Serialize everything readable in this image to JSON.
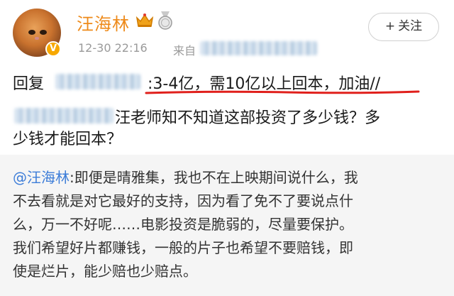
{
  "post": {
    "username": "汪海林",
    "time": "12-30 22:16",
    "from_label": "来自",
    "follow_plus": "+",
    "follow_label": "关注",
    "reply_prefix": "回复",
    "reply_text_line1": ":3-4亿，需10亿以上回本，加油//",
    "reply_text_line2": "汪老师知不知道这部投资了多少钱？多",
    "reply_text_line3": "少钱才能回本？"
  },
  "quote": {
    "mention": "@汪海林",
    "line1": ":即便是晴雅集，我也不在上映期间说什么，我",
    "line2": "不去看就是对它最好的支持，因为看了免不了要说点什",
    "line3": "么，万一不好呢……电影投资是脆弱的，尽量要保护。",
    "line4": "我们希望好片都赚钱，一般的片子也希望不要赔钱，即",
    "line5": "使是烂片，能少赔也少赔点。"
  },
  "colors": {
    "username": "#ee8a1a",
    "mention": "#3d7dd8",
    "underline": "#e0201c",
    "quote_bg": "#f5f5f5",
    "vip_badge": "#f7a800"
  },
  "icons": {
    "avatar": "cat-avatar",
    "verified": "verified-v-icon",
    "crown": "crown-icon",
    "medal": "medal-icon"
  }
}
